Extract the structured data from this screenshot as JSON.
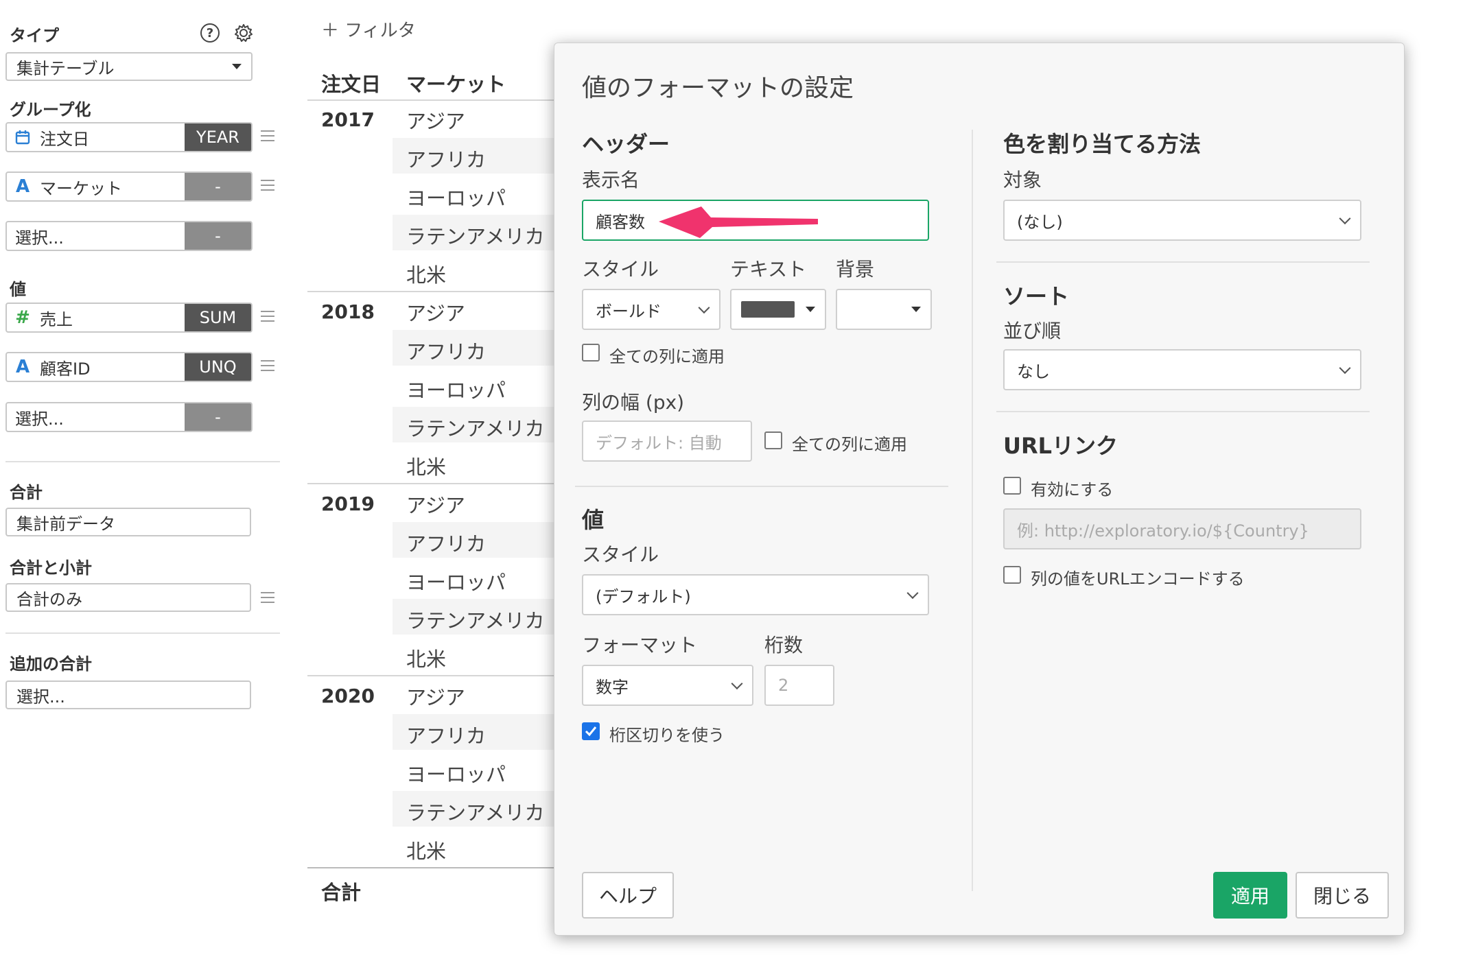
{
  "left": {
    "type_label": "タイプ",
    "type_value": "集計テーブル",
    "group_label": "グループ化",
    "groups": [
      {
        "name": "注文日",
        "agg": "YEAR",
        "icon": "calendar-icon"
      },
      {
        "name": "マーケット",
        "agg": "-",
        "icon": "text-type-icon"
      },
      {
        "name": "選択...",
        "agg": "-"
      }
    ],
    "values_label": "値",
    "values": [
      {
        "name": "売上",
        "agg": "SUM",
        "icon": "number-type-icon"
      },
      {
        "name": "顧客ID",
        "agg": "UNQ",
        "icon": "text-type-icon"
      },
      {
        "name": "選択...",
        "agg": "-"
      }
    ],
    "total_label": "合計",
    "total_value": "集計前データ",
    "subtotal_label": "合計と小計",
    "subtotal_value": "合計のみ",
    "extra_total_label": "追加の合計",
    "extra_total_value": "選択...",
    "type_glyph_text": "A",
    "type_glyph_number": "#"
  },
  "table": {
    "filter_label": "＋ フィルタ",
    "headers": [
      "注文日",
      "マーケット"
    ],
    "markets": [
      "アジア",
      "アフリカ",
      "ヨーロッパ",
      "ラテンアメリカ",
      "北米"
    ],
    "years": [
      "2017",
      "2018",
      "2019",
      "2020"
    ],
    "total_label": "合計"
  },
  "dialog": {
    "title": "値のフォーマットの設定",
    "header_section": "ヘッダー",
    "display_name_label": "表示名",
    "display_name_value": "顧客数",
    "style_label": "スタイル",
    "text_label": "テキスト",
    "bg_label": "背景",
    "style_value": "ボールド",
    "text_color": "#555555",
    "apply_all_1": "全ての列に適用",
    "col_width_label": "列の幅 (px)",
    "col_width_placeholder": "デフォルト: 自動",
    "apply_all_2": "全ての列に適用",
    "value_section": "値",
    "value_style_label": "スタイル",
    "value_style_value": "(デフォルト)",
    "format_label": "フォーマット",
    "digits_label": "桁数",
    "format_value": "数字",
    "digits_value": "2",
    "separator_label": "桁区切りを使う",
    "color_section": "色を割り当てる方法",
    "target_label": "対象",
    "target_value": "(なし)",
    "sort_section": "ソート",
    "order_label": "並び順",
    "order_value": "なし",
    "url_section": "URLリンク",
    "enable_label": "有効にする",
    "url_placeholder": "例: http://exploratory.io/${Country}",
    "encode_label": "列の値をURLエンコードする",
    "help_button": "ヘルプ",
    "apply_button": "適用",
    "close_button": "閉じる",
    "accent_color": "#1aa566",
    "arrow_color": "#f0336d"
  }
}
